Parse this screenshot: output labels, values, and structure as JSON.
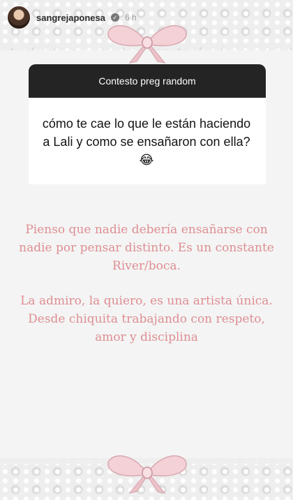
{
  "story": {
    "username": "sangrejaponesa",
    "time": "6 h",
    "verified_symbol": "✓"
  },
  "question_box": {
    "header": "Contesto preg random",
    "question": "cómo te cae lo que le están haciendo a Lali y como se ensañaron con ella?",
    "emoji": "😂"
  },
  "answer": {
    "paragraph_1": "Pienso que nadie debería ensañarse con nadie por pensar distinto. Es un constante River/boca.",
    "paragraph_2": "La admiro, la quiero, es una artista única. Desde chiquita trabajando con respeto, amor y disciplina"
  },
  "colors": {
    "question_header_bg": "#242424",
    "answer_text": "#de8e92",
    "bow_pink": "#f3d1d6"
  },
  "icons": [
    "verified-badge-icon",
    "bow-decoration-icon"
  ]
}
